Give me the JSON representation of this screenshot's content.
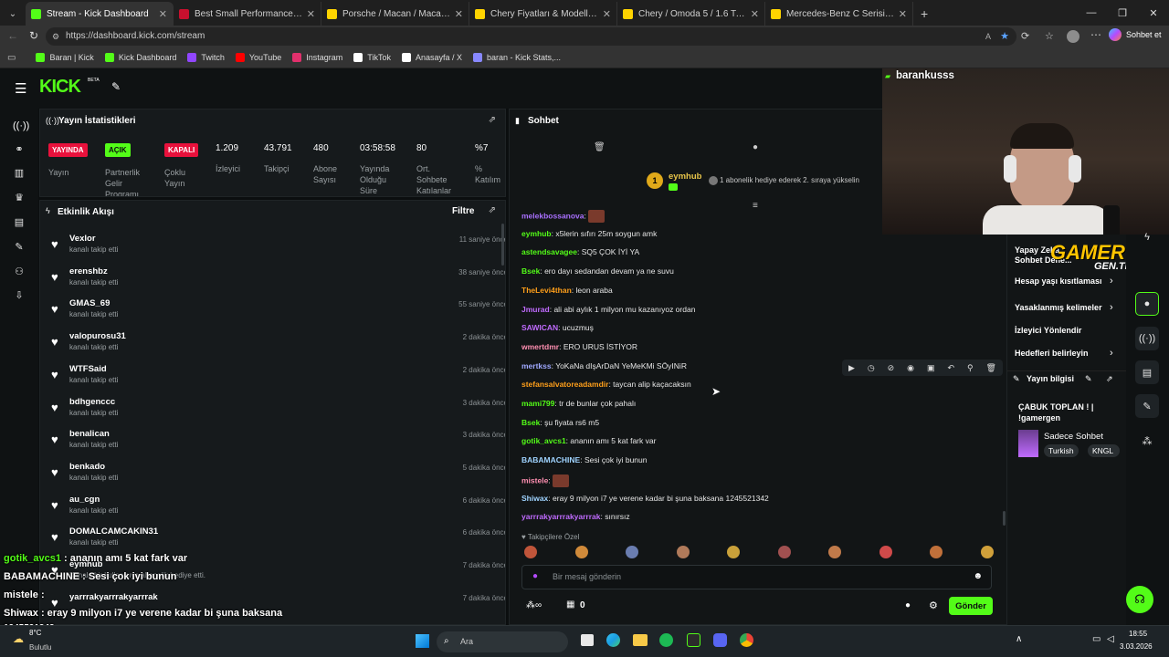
{
  "colors": {
    "kick_green": "#53fc18",
    "live_red": "#e9113c",
    "panel": "#161a1c",
    "bg": "#0b0e0f"
  },
  "browser": {
    "tabs": [
      {
        "title": "Stream - Kick Dashboard",
        "fav": "#53fc18",
        "active": true
      },
      {
        "title": "Best Small Performance SUVs for 2",
        "fav": "#c8102e"
      },
      {
        "title": "Porsche / Macan / Macan GTS / M",
        "fav": "#ffd400"
      },
      {
        "title": "Chery Fiyatları & Modelleri sahibin",
        "fav": "#ffd400"
      },
      {
        "title": "Chery / Omoda 5 / 1.6 T-GDI / Lu",
        "fav": "#ffd400"
      },
      {
        "title": "Mercedes-Benz C Serisi C 180 AM",
        "fav": "#ffd400"
      }
    ],
    "url": "https://dashboard.kick.com/stream",
    "profile_label": "Sohbet et",
    "bookmarks": [
      {
        "label": "Baran | Kick",
        "color": "#53fc18"
      },
      {
        "label": "Kick Dashboard",
        "color": "#53fc18"
      },
      {
        "label": "Twitch",
        "color": "#9146ff"
      },
      {
        "label": "YouTube",
        "color": "#ff0000"
      },
      {
        "label": "Instagram",
        "color": "#e1306c"
      },
      {
        "label": "TikTok",
        "color": "#ffffff"
      },
      {
        "label": "Anasayfa / X",
        "color": "#ffffff"
      },
      {
        "label": "baran - Kick Stats,...",
        "color": "#8888ff"
      }
    ]
  },
  "app": {
    "logo": "KICK",
    "logo_sup": "BETA"
  },
  "stats": {
    "title": "Yayın İstatistikleri",
    "items": [
      {
        "badge": "YAYINDA",
        "label": "Yayın"
      },
      {
        "badge": "AÇIK",
        "label": "Partnerlik Gelir Programı"
      },
      {
        "badge": "KAPALI",
        "label": "Çoklu Yayın"
      },
      {
        "value": "1.209",
        "label": "İzleyici"
      },
      {
        "value": "43.791",
        "label": "Takipçi"
      },
      {
        "value": "480",
        "label": "Abone Sayısı"
      },
      {
        "value": "03:58:58",
        "label": "Yayında Olduğu Süre"
      },
      {
        "value": "80",
        "label": "Ort. Sohbete Katılanlar"
      },
      {
        "value": "%7",
        "label": "% Katılım"
      }
    ]
  },
  "activity": {
    "title": "Etkinlik Akışı",
    "filter": "Filtre",
    "items": [
      {
        "name": "Vexlor",
        "sub": "kanalı takip etti",
        "time": "11 saniye önce"
      },
      {
        "name": "erenshbz",
        "sub": "kanalı takip etti",
        "time": "38 saniye önce"
      },
      {
        "name": "GMAS_69",
        "sub": "kanalı takip etti",
        "time": "55 saniye önce"
      },
      {
        "name": "valopurosu31",
        "sub": "kanalı takip etti",
        "time": "2 dakika önce"
      },
      {
        "name": "WTFSaid",
        "sub": "kanalı takip etti",
        "time": "2 dakika önce"
      },
      {
        "name": "bdhgenccc",
        "sub": "kanalı takip etti",
        "time": "3 dakika önce"
      },
      {
        "name": "benalican",
        "sub": "kanalı takip etti",
        "time": "3 dakika önce"
      },
      {
        "name": "benkado",
        "sub": "kanalı takip etti",
        "time": "5 dakika önce"
      },
      {
        "name": "au_cgn",
        "sub": "kanalı takip etti",
        "time": "6 dakika önce"
      },
      {
        "name": "DOMALCAMCAKIN31",
        "sub": "kanalı takip etti",
        "time": "6 dakika önce"
      },
      {
        "name": "eymhub",
        "sub": "Kanala bir kullanıcıya abonelik hediye etti.",
        "time": "7 dakika önce"
      },
      {
        "name": "yarrrakyarrrakyarrrak",
        "sub": "",
        "time": "7 dakika önce"
      }
    ]
  },
  "chat": {
    "title": "Sohbet",
    "pinned_user": "eymhub",
    "pinned_rank": "1",
    "pinned_msg": "1 abonelik hediye ederek 2. sıraya yükselin",
    "messages": [
      {
        "user": "melekbossanova",
        "text": "",
        "color": "#a970ff"
      },
      {
        "user": "eymhub",
        "text": "x5lerin sıfırı 25m soygun amk",
        "color": "#53fc18"
      },
      {
        "user": "astendsavagee",
        "text": "SQ5 ÇOK İYİ YA",
        "color": "#53fc18"
      },
      {
        "user": "Bsek",
        "text": "ero dayı sedandan devam ya ne suvu",
        "color": "#53fc18"
      },
      {
        "user": "TheLevi4than",
        "text": "leon araba",
        "color": "#ff9f1a"
      },
      {
        "user": "Jmurad",
        "text": "ali abi aylık 1 milyon mu kazanıyoz ordan",
        "color": "#c06bff"
      },
      {
        "user": "SAWICAN",
        "text": "ucuzmuş",
        "color": "#c06bff"
      },
      {
        "user": "wmertdmr",
        "text": "ERO URUS İSTİYOR",
        "color": "#ff8fb1"
      },
      {
        "user": "mertkss",
        "text": "YoKaNa dIşArDaN YeMeKMi SÖyINiR",
        "color": "#9fa8ff"
      },
      {
        "user": "stefansalvatoreadamdir",
        "text": "taycan alip kaçacaksın",
        "color": "#ff9f1a"
      },
      {
        "user": "mami799",
        "text": "tr de bunlar çok pahalı",
        "color": "#53fc18"
      },
      {
        "user": "Bsek",
        "text": "şu fiyata rs6 m5",
        "color": "#53fc18"
      },
      {
        "user": "gotik_avcs1",
        "text": "ananın amı 5 kat fark var",
        "color": "#53fc18"
      },
      {
        "user": "BABAMACHINE",
        "text": "Sesi çok iyi bunun",
        "color": "#9fd3ff"
      },
      {
        "user": "mistele",
        "text": "",
        "color": "#ff8fb1"
      },
      {
        "user": "Shiwax",
        "text": "eray 9 milyon i7 ye verene kadar bi şuna baksana 1245521342",
        "color": "#9fd3ff"
      },
      {
        "user": "yarrrakyarrrakyarrrak",
        "text": "sınırsız",
        "color": "#c06bff"
      }
    ],
    "followers_only": "Takipçilere Özel",
    "input_placeholder": "Bir mesaj gönderin",
    "points": "0",
    "send": "Gönder"
  },
  "overlay": {
    "streamer": "barankusss",
    "chat": [
      {
        "user": "gotik_avcs1",
        "text": " : ananın amı 5 kat fark var",
        "color": "#53fc18"
      },
      {
        "user": "BABAMACHINE",
        "text": " : Sesi çok iyi bunun",
        "color": "#ffffff"
      },
      {
        "user": "mistele",
        "text": " :",
        "color": "#ffffff"
      },
      {
        "user": "Shiwax",
        "text": " : eray 9 milyon i7 ye verene kadar bi şuna baksana",
        "color": "#ffffff"
      }
    ],
    "extra_line": "1245521342",
    "gamer_logo": "GAMER",
    "gamer_sub": "GEN.TR"
  },
  "right_panel": {
    "items": [
      {
        "label": "Yapay Zeka Sohbet Dene..."
      },
      {
        "label": "Hesap yaşı kısıtlaması"
      },
      {
        "label": "Yasaklanmış kelimeler"
      },
      {
        "label": "İzleyici Yönlendir"
      },
      {
        "label": "Hedefleri belirleyin"
      }
    ],
    "info_title": "Yayın bilgisi",
    "stream_title": "ÇABUK TOPLAN ! | !gamergen",
    "category": "Sadece Sohbet",
    "tags": [
      "Turkish",
      "KNGL"
    ]
  },
  "taskbar": {
    "weather_temp": "8°C",
    "weather_text": "Bulutlu",
    "search": "Ara",
    "time": "18:55",
    "date": "3.03.2026"
  }
}
